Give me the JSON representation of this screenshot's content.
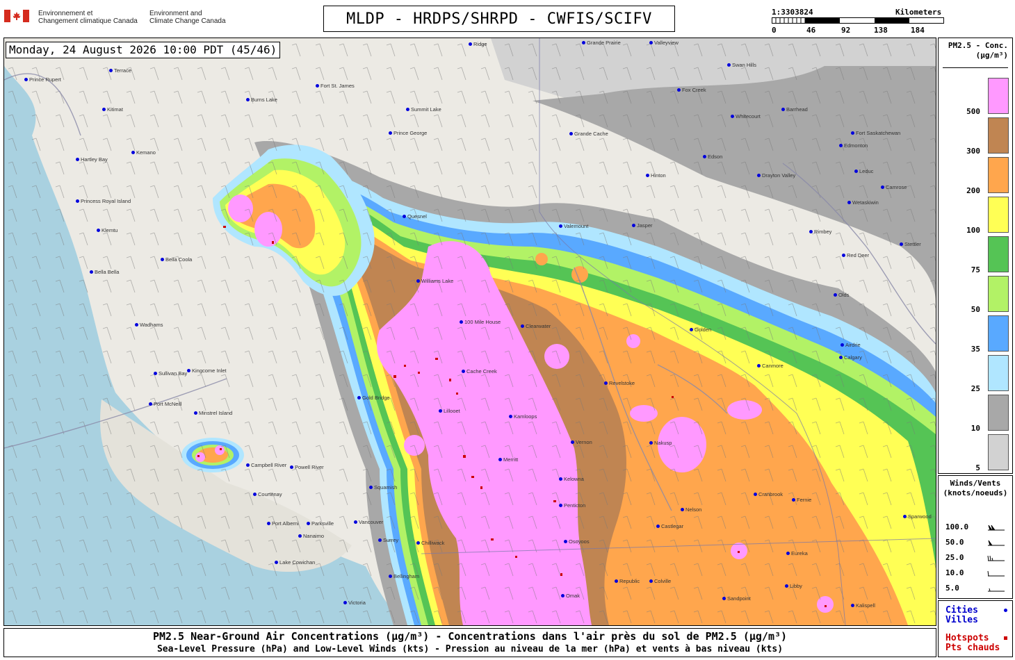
{
  "header": {
    "gov_fr_line1": "Environnement et",
    "gov_fr_line2": "Changement climatique Canada",
    "gov_en_line1": "Environment and",
    "gov_en_line2": "Climate Change Canada",
    "title": "MLDP - HRDPS/SHRPD - CWFIS/SCIFV",
    "scale_ratio": "1:3303824",
    "scale_units": "Kilometers",
    "scale_ticks": [
      "0",
      "46",
      "92",
      "138",
      "184"
    ]
  },
  "map": {
    "timestamp": "Monday, 24 August 2026 10:00 PDT (45/46)",
    "cities": [
      "Prince Rupert",
      "Terrace",
      "Kitimat",
      "Kemano",
      "Hartley Bay",
      "Princess Royal Island",
      "Klemtu",
      "Bella Bella",
      "Bella Coola",
      "Wadhams",
      "Sullivan Bay",
      "Port McNeill",
      "Kingcome Inlet",
      "Minstrel Island",
      "Campbell River",
      "Powell River",
      "Courtenay",
      "Port Alberni",
      "Parksville",
      "Nanaimo",
      "Lake Cowichan",
      "Victoria",
      "Vancouver",
      "Surrey",
      "Squamish",
      "Bellingham",
      "Burns Lake",
      "Fort St. James",
      "Prince George",
      "Summit Lake",
      "Quesnel",
      "Williams Lake",
      "100 Mile House",
      "Clearwater",
      "Cache Creek",
      "Kamloops",
      "Lillooet",
      "Gold Bridge",
      "Vernon",
      "Kelowna",
      "Penticton",
      "Osoyoos",
      "Merritt",
      "Revelstoke",
      "Nakusp",
      "Nelson",
      "Castlegar",
      "Cranbrook",
      "Fernie",
      "Golden",
      "Canmore",
      "Valemount",
      "Jasper",
      "Hinton",
      "Edson",
      "Whitecourt",
      "Fox Creek",
      "Swan Hills",
      "Barrhead",
      "Fort Saskatchewan",
      "Edmonton",
      "Leduc",
      "Camrose",
      "Wetaskiwin",
      "Drayton Valley",
      "Rimbey",
      "Red Deer",
      "Stettler",
      "Olds",
      "Airdrie",
      "Calgary",
      "Sparwood",
      "Eureka",
      "Libby",
      "Kalispell",
      "Sandpoint",
      "Colville",
      "Republic",
      "Omak",
      "Chilliwack",
      "Grande Prairie",
      "Grande Cache",
      "Valleyview",
      "Ridge"
    ],
    "hotspot_color": "#cc0000",
    "city_color": "#0000dd"
  },
  "legend": {
    "title_line1": "PM2.5 - Conc.",
    "title_line2": "(µg/m³)",
    "bins": [
      {
        "label": "500",
        "color": "#ff99ff"
      },
      {
        "label": "300",
        "color": "#c08552"
      },
      {
        "label": "200",
        "color": "#ffa64d"
      },
      {
        "label": "100",
        "color": "#ffff55"
      },
      {
        "label": "75",
        "color": "#55c455"
      },
      {
        "label": "50",
        "color": "#b2f266"
      },
      {
        "label": "35",
        "color": "#59a9ff"
      },
      {
        "label": "25",
        "color": "#b0e6ff"
      },
      {
        "label": "10",
        "color": "#a8a8a8"
      },
      {
        "label": "5",
        "color": "#d2d2d2"
      }
    ]
  },
  "winds": {
    "title_line1": "Winds/Vents",
    "title_line2": "(knots/noeuds)",
    "rows": [
      "100.0",
      "50.0",
      "25.0",
      "10.0",
      "5.0"
    ]
  },
  "key": {
    "cities_line1": "Cities",
    "cities_line2": "Villes",
    "hotspots_line1": "Hotspots",
    "hotspots_line2": "Pts chauds"
  },
  "footer": {
    "line1": "PM2.5 Near-Ground Air Concentrations (µg/m³) - Concentrations dans l'air près du sol de PM2.5 (µg/m³)",
    "line2": "Sea-Level Pressure (hPa) and Low-Level Winds (kts) - Pression au niveau de la mer (hPa) et vents à bas niveau (kts)"
  }
}
